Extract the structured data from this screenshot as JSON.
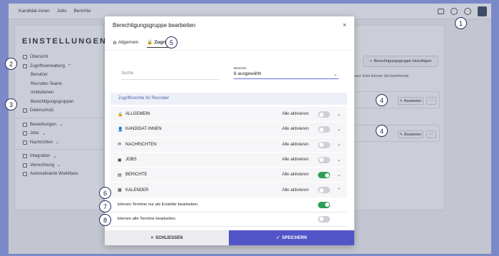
{
  "app": {
    "topnav": [
      "Kandidat·innen",
      "Jobs",
      "Berichte"
    ]
  },
  "sidebar": {
    "title": "EINSTELLUNGEN",
    "items": [
      {
        "label": "Übersicht",
        "icon": "info-icon"
      },
      {
        "label": "Zugriffsverwaltung",
        "icon": "lock-icon",
        "expanded": true
      },
      {
        "label": "Benutzer",
        "sub": true
      },
      {
        "label": "Recruiter-Teams",
        "sub": true
      },
      {
        "label": "Institutionen",
        "sub": true
      },
      {
        "label": "Berechtigungsgruppen",
        "sub": true
      },
      {
        "label": "Datenschutz",
        "icon": "shield-icon"
      },
      {
        "label": "Bewerbungen",
        "icon": "inbox-icon",
        "dropdown": true
      },
      {
        "label": "Jobs",
        "icon": "briefcase-icon",
        "dropdown": true
      },
      {
        "label": "Nachrichten",
        "icon": "mail-icon",
        "dropdown": true
      },
      {
        "label": "Integration",
        "icon": "terminal-icon",
        "dropdown": true
      },
      {
        "label": "Verrechnung",
        "icon": "card-icon",
        "dropdown": true
      },
      {
        "label": "Automatisierte Workflows",
        "icon": "workflow-icon"
      }
    ]
  },
  "content": {
    "add_button": "Berechtigungsgruppe hinzufügen",
    "note": "dieser Seite können Sie bestehende",
    "edit_label": "Bearbeiten",
    "more_label": "···"
  },
  "modal": {
    "title": "Berechtigungsgruppe bearbeiten",
    "close": "×",
    "tabs": [
      {
        "label": "Allgemein",
        "icon": "gear-icon",
        "active": false
      },
      {
        "label": "Zugriff",
        "icon": "lock-icon",
        "active": true
      }
    ],
    "search_placeholder": "Suche",
    "select": {
      "label": "Bereiche",
      "value": "6 ausgewählt",
      "chevron": "⌄"
    },
    "section_header": "Zugriffsrechte für Recruiter",
    "activate_all": "Alle aktivieren",
    "rows": [
      {
        "label": "ALLGEMEIN",
        "icon": "lock-icon",
        "glyph": "🔒",
        "on": false,
        "chevron": "⌄"
      },
      {
        "label": "KANDIDAT·INNEN",
        "icon": "person-icon",
        "glyph": "👤",
        "on": false,
        "chevron": "⌄"
      },
      {
        "label": "NACHRICHTEN",
        "icon": "mail-icon",
        "glyph": "✉",
        "on": false,
        "chevron": "⌄"
      },
      {
        "label": "JOBS",
        "icon": "briefcase-icon",
        "glyph": "▣",
        "on": false,
        "chevron": "⌄"
      },
      {
        "label": "BERICHTE",
        "icon": "chart-icon",
        "glyph": "▤",
        "on": true,
        "chevron": "⌄"
      },
      {
        "label": "KALENDER",
        "icon": "calendar-icon",
        "glyph": "▦",
        "on": false,
        "chevron": "⌃"
      }
    ],
    "subrows": [
      {
        "label": "können Termine nur als Ersteller bearbeiten.",
        "on": true
      },
      {
        "label": "können alle Termine bearbeiten.",
        "on": false
      }
    ],
    "cancel_label": "SCHLIESSEN",
    "cancel_icon": "×",
    "save_label": "SPEICHERN",
    "save_icon": "✓"
  },
  "callouts": [
    "1",
    "2",
    "3",
    "4",
    "4",
    "5",
    "6",
    "7",
    "8"
  ],
  "colors": {
    "background": "#8fa1ea",
    "accent": "#5255c7",
    "toggle_on": "#2e9e55",
    "section_header_text": "#4a5fae"
  }
}
